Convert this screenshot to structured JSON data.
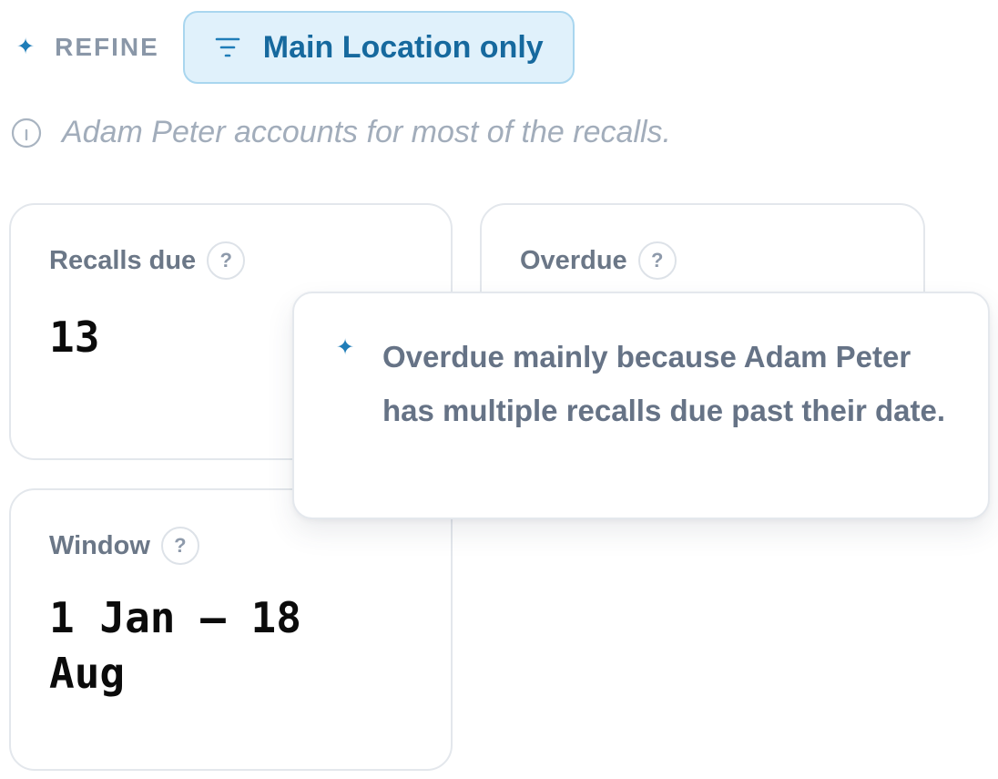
{
  "refine": {
    "icon": "sparkle-icon",
    "label": "REFINE",
    "chip": {
      "icon": "filter-icon",
      "label": "Main Location only"
    }
  },
  "info": {
    "icon": "info-icon",
    "text": "Adam Peter accounts for most of the recalls."
  },
  "cards": {
    "recalls_due": {
      "title": "Recalls due",
      "help": "?",
      "value": "13"
    },
    "overdue": {
      "title": "Overdue",
      "help": "?"
    },
    "window": {
      "title": "Window",
      "help": "?",
      "value": "1 Jan – 18 Aug"
    }
  },
  "popover": {
    "icon": "sparkle-icon",
    "text": "Overdue mainly because Adam Peter has multiple recalls due past their date."
  },
  "colors": {
    "accent": "#1f7db8",
    "chip_bg": "#e0f1fb",
    "chip_border": "#a9d6ef",
    "muted_text": "#8a97a8"
  }
}
